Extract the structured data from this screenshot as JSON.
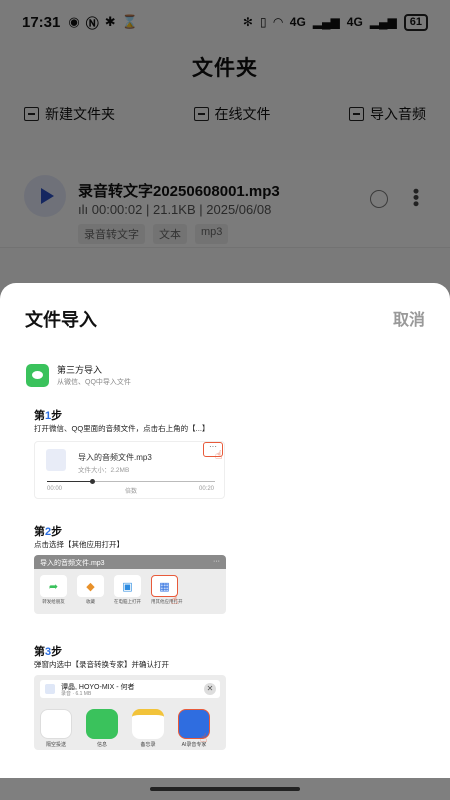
{
  "status_bar": {
    "time": "17:31",
    "battery": "61",
    "signal_label_1": "4G",
    "signal_label_2": "4G",
    "icons": [
      "eye-icon",
      "nfc-icon",
      "shield-icon",
      "hourglass-icon",
      "bluetooth-icon",
      "vibrate-icon",
      "wifi-icon",
      "signal-icon",
      "battery-icon"
    ]
  },
  "page": {
    "title": "文件夹",
    "toolbar": {
      "new_folder": "新建文件夹",
      "online_files": "在线文件",
      "import_audio": "导入音频"
    },
    "file": {
      "name": "录音转文字20250608001.mp3",
      "duration": "00:00:02",
      "size": "21.1KB",
      "date": "2025/06/08",
      "tags": [
        "录音转文字",
        "文本",
        "mp3"
      ]
    }
  },
  "sheet": {
    "title": "文件导入",
    "cancel": "取消",
    "third_party": {
      "title": "第三方导入",
      "subtitle": "从微信、QQ中导入文件"
    },
    "step1": {
      "label": "第",
      "num": "1",
      "suffix": "步",
      "desc": "打开微信、QQ里面的音频文件，点击右上角的【...】",
      "file_name": "导入的音频文件.mp3",
      "file_size": "文件大小：2.2MB",
      "dots": "···",
      "t_start": "00:00",
      "speed": "倍数",
      "t_end": "00:20"
    },
    "step2": {
      "label": "第",
      "num": "2",
      "suffix": "步",
      "desc": "点击选择【其他应用打开】",
      "header": "导入的音频文件.mp3",
      "header_dots": "···",
      "apps": [
        "转发给朋友",
        "收藏",
        "在电脑上打开",
        "用其他应用打开"
      ]
    },
    "step3": {
      "label": "第",
      "num": "3",
      "suffix": "步",
      "desc": "弹窗内选中【录音转换专家】并确认打开",
      "file_name": "谭晶, HOYO-MIX - 何者",
      "file_meta": "录音 · 6.1 MB",
      "close": "✕",
      "apps": [
        "隔空投送",
        "信息",
        "备忘录",
        "AI录音专家"
      ]
    }
  },
  "colors": {
    "accent": "#2b6ee0",
    "highlight": "#e85a3a",
    "wechat": "#3ac25c",
    "play": "#2b4ec0"
  }
}
